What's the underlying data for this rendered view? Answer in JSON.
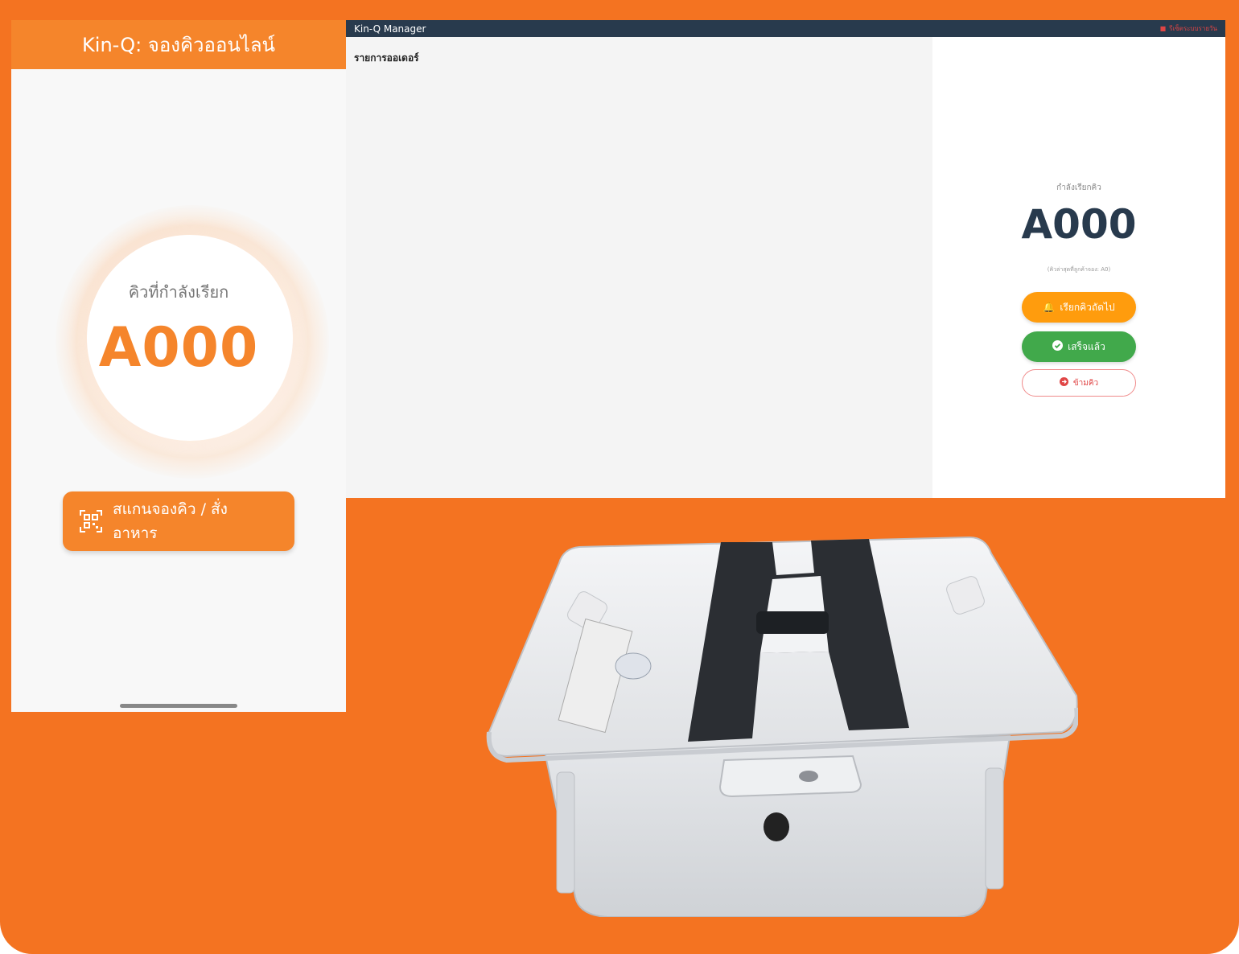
{
  "mobile_app": {
    "header_title": "Kin-Q: จองคิวออนไลน์",
    "current_queue_label": "คิวที่กำลังเรียก",
    "current_queue_number": "A000",
    "scan_button_label": "สแกนจองคิว / สั่ง อาหาร"
  },
  "manager": {
    "app_title": "Kin-Q Manager",
    "top_right_action": "รีเซ็ตระบบรายวัน",
    "orders_title": "รายการออเดอร์",
    "current_label": "กำลังเรียกคิว",
    "current_number": "A000",
    "latest_issued": "(คิวล่าสุดที่ลูกค้าจอง: A0)",
    "call_next_label": "เรียกคิวถัดไป",
    "done_label": "เสร็จแล้ว",
    "skip_label": "ข้ามคิว"
  },
  "colors": {
    "frame_orange": "#f47321",
    "mobile_accent": "#f5852b",
    "manager_bar": "#283a4d",
    "call_next": "#ff9c0d",
    "done": "#41a94b",
    "skip": "#e04545"
  }
}
